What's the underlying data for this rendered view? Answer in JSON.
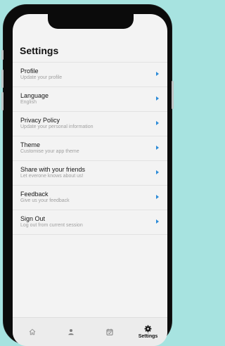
{
  "page": {
    "title": "Settings"
  },
  "settings": {
    "items": [
      {
        "title": "Profile",
        "subtitle": "Update your profile"
      },
      {
        "title": "Language",
        "subtitle": "English"
      },
      {
        "title": "Privacy Policy",
        "subtitle": "Update your personal information"
      },
      {
        "title": "Theme",
        "subtitle": "Customise your app theme"
      },
      {
        "title": "Share with your friends",
        "subtitle": "Let everone knows about us!"
      },
      {
        "title": "Feedback",
        "subtitle": "Give us your feedback"
      },
      {
        "title": "Sign Out",
        "subtitle": "Log out from current session"
      }
    ]
  },
  "tabbar": {
    "tabs": [
      {
        "icon": "home-icon",
        "label": ""
      },
      {
        "icon": "person-icon",
        "label": ""
      },
      {
        "icon": "calendar-icon",
        "label": ""
      },
      {
        "icon": "gear-icon",
        "label": "Settings",
        "active": true
      }
    ]
  },
  "colors": {
    "background": "#a7e3e0",
    "accent": "#2b8bd8",
    "inactive_icon": "#9a9a9a"
  }
}
